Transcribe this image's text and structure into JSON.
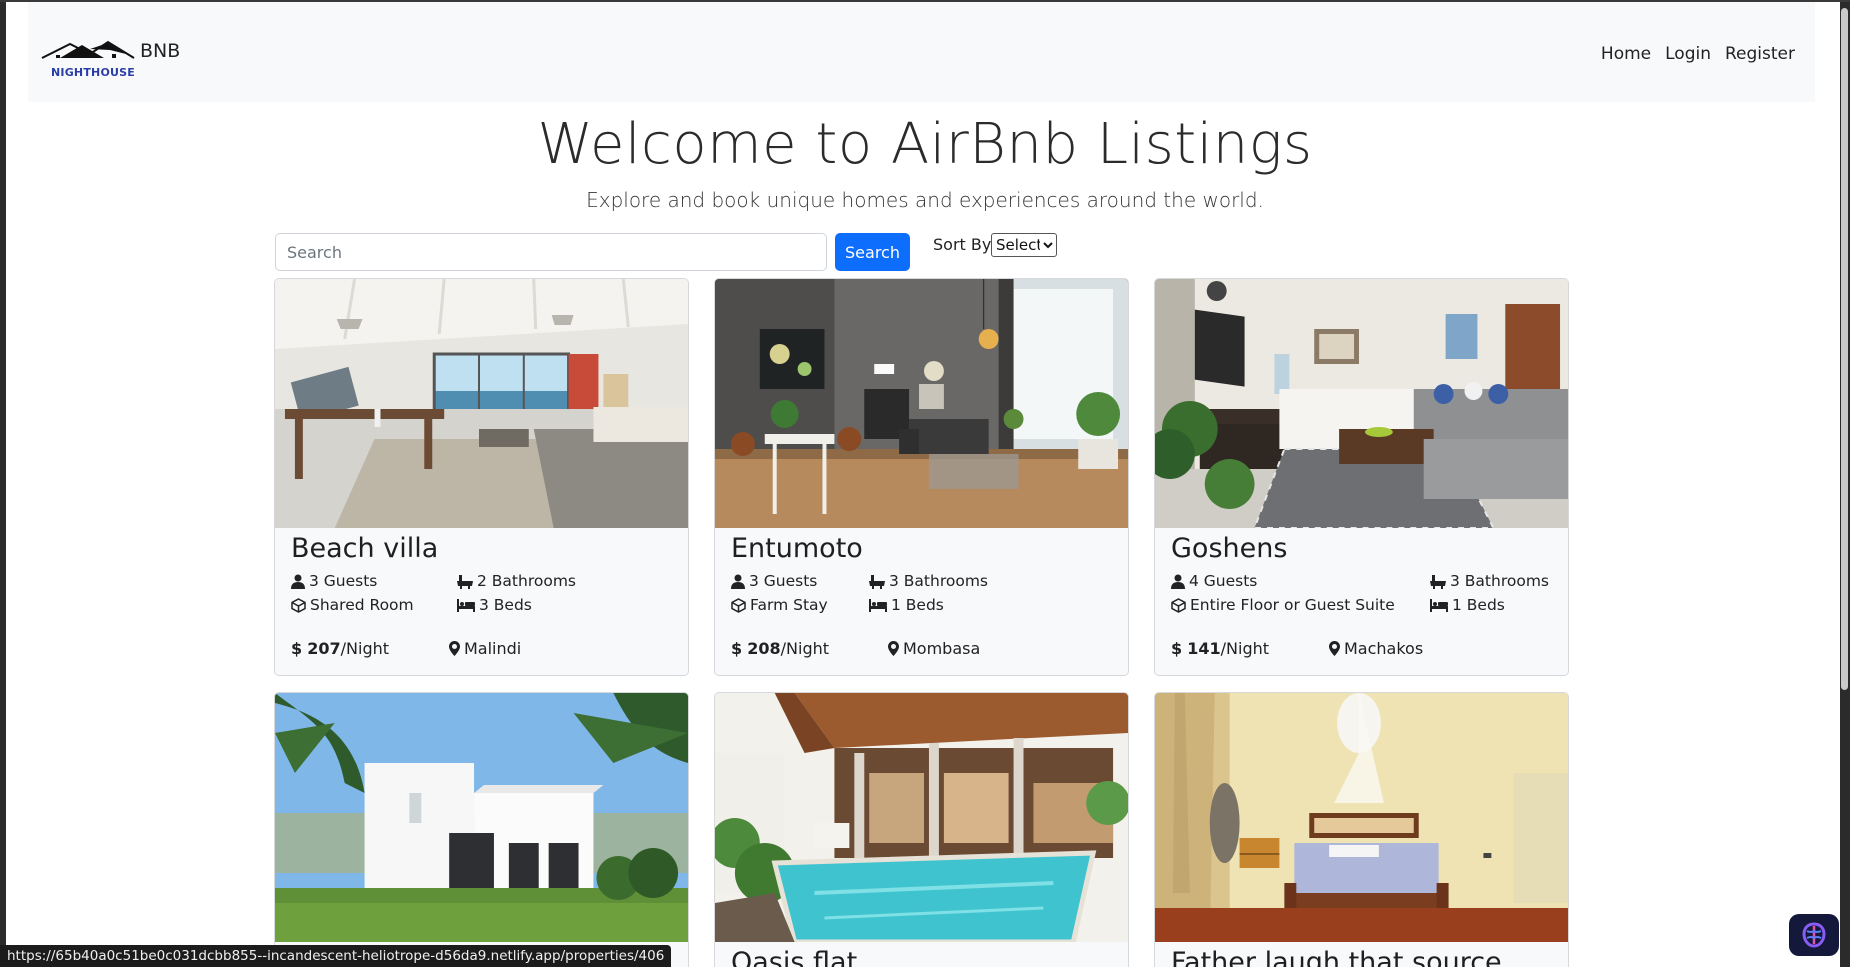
{
  "brand": {
    "name": "BNB",
    "sub": "NIGHTHOUSE"
  },
  "nav": {
    "home": "Home",
    "login": "Login",
    "register": "Register"
  },
  "hero": {
    "title": "Welcome to AirBnb Listings",
    "subtitle": "Explore and book unique homes and experiences around the world."
  },
  "search": {
    "placeholder": "Search",
    "button": "Search",
    "sort_label": "Sort By:",
    "sort_value": "Select"
  },
  "listings": [
    {
      "title": "Beach villa",
      "guests": "3 Guests",
      "bathrooms": "2 Bathrooms",
      "room_type": "Shared Room",
      "beds": "3 Beds",
      "currency": "$",
      "price": "207",
      "per": "/Night",
      "location": "Malindi"
    },
    {
      "title": "Entumoto",
      "guests": "3 Guests",
      "bathrooms": "3 Bathrooms",
      "room_type": "Farm Stay",
      "beds": "1 Beds",
      "currency": "$",
      "price": "208",
      "per": "/Night",
      "location": "Mombasa"
    },
    {
      "title": "Goshens",
      "guests": "4 Guests",
      "bathrooms": "3 Bathrooms",
      "room_type": "Entire Floor or Guest Suite",
      "beds": "1 Beds",
      "currency": "$",
      "price": "141",
      "per": "/Night",
      "location": "Machakos"
    },
    {
      "title": ""
    },
    {
      "title": "Oasis flat"
    },
    {
      "title": "Father laugh that source."
    }
  ],
  "status_bar": {
    "url": "https://65b40a0c51be0c031dcbb855--incandescent-heliotrope-d56da9.netlify.app/properties/406"
  },
  "icons": {
    "guests": "person-icon",
    "bathrooms": "bathtub-icon",
    "room_type": "cube-icon",
    "beds": "bed-icon",
    "location": "map-pin-icon"
  },
  "colors": {
    "primary": "#0d6efd",
    "navbar_bg": "#f8f9fa",
    "brand_sub": "#2b3ea8"
  }
}
